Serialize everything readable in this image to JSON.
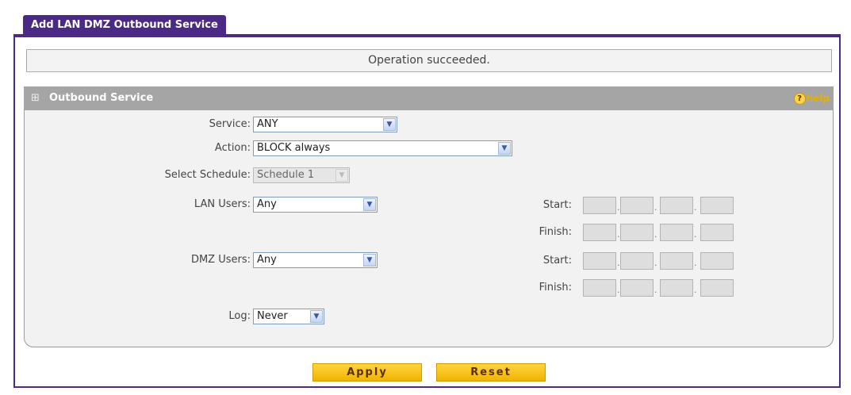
{
  "tab": {
    "title": "Add LAN DMZ Outbound Service"
  },
  "status": {
    "message": "Operation succeeded."
  },
  "panel": {
    "title": "Outbound Service",
    "help_label": "help",
    "help_icon_glyph": "?"
  },
  "form": {
    "service": {
      "label": "Service:",
      "value": "ANY"
    },
    "action": {
      "label": "Action:",
      "value": "BLOCK always"
    },
    "schedule": {
      "label": "Select Schedule:",
      "value": "Schedule 1"
    },
    "lan_users": {
      "label": "LAN Users:",
      "value": "Any"
    },
    "dmz_users": {
      "label": "DMZ Users:",
      "value": "Any"
    },
    "log": {
      "label": "Log:",
      "value": "Never"
    },
    "lan_start_label": "Start:",
    "lan_finish_label": "Finish:",
    "dmz_start_label": "Start:",
    "dmz_finish_label": "Finish:"
  },
  "buttons": {
    "apply": "Apply",
    "reset": "Reset"
  },
  "icons": {
    "dropdown": "chevron-down-icon",
    "grip": "grip-icon",
    "help": "help-icon"
  },
  "colors": {
    "accent": "#4b2a86",
    "button": "#f5bd12",
    "panel_header": "#a5a5a5"
  }
}
